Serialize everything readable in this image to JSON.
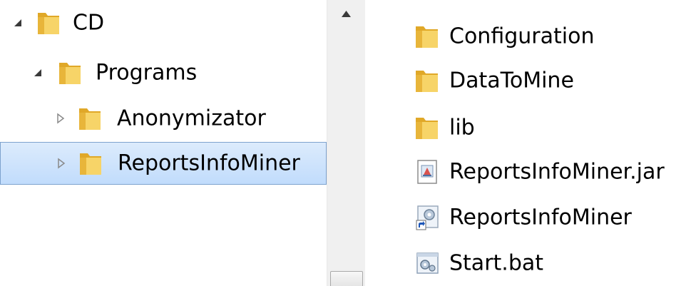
{
  "navigation_tree": {
    "items": [
      {
        "label": "CD",
        "expanded": true,
        "selected": false,
        "icon": "folder-icon",
        "toggle": "expanded-arrow-icon"
      },
      {
        "label": "Programs",
        "expanded": true,
        "selected": false,
        "icon": "folder-icon",
        "toggle": "expanded-arrow-icon"
      },
      {
        "label": "Anonymizator",
        "expanded": false,
        "selected": false,
        "icon": "folder-icon",
        "toggle": "collapsed-arrow-icon"
      },
      {
        "label": "ReportsInfoMiner",
        "expanded": false,
        "selected": true,
        "icon": "folder-icon",
        "toggle": "collapsed-arrow-icon"
      }
    ]
  },
  "file_list": {
    "items": [
      {
        "name": "Configuration",
        "icon": "folder-icon"
      },
      {
        "name": "DataToMine",
        "icon": "folder-icon"
      },
      {
        "name": "lib",
        "icon": "folder-icon"
      },
      {
        "name": "ReportsInfoMiner.jar",
        "icon": "jar-file-icon"
      },
      {
        "name": "ReportsInfoMiner",
        "icon": "shortcut-icon"
      },
      {
        "name": "Start.bat",
        "icon": "batch-file-icon"
      }
    ]
  },
  "colors": {
    "selection_background": "#cce4fc",
    "selection_border": "#7da2ce",
    "folder_yellow": "#f2c94c",
    "text": "#000000"
  }
}
